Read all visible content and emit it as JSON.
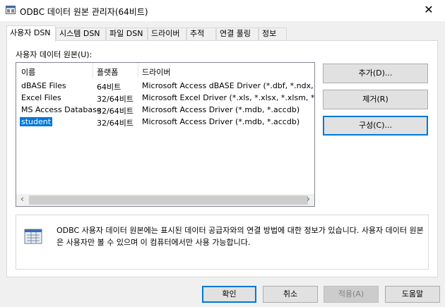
{
  "window": {
    "title": "ODBC 데이터 원본 관리자(64비트)",
    "close_glyph": "✕"
  },
  "tabs": [
    {
      "label": "사용자 DSN"
    },
    {
      "label": "시스템 DSN"
    },
    {
      "label": "파일 DSN"
    },
    {
      "label": "드라이버"
    },
    {
      "label": "추적"
    },
    {
      "label": "연결 풀링"
    },
    {
      "label": "정보"
    }
  ],
  "user_dsn": {
    "list_label": "사용자 데이터 원본(U):",
    "columns": [
      "이름",
      "플랫폼",
      "드라이버"
    ],
    "rows": [
      {
        "name": "dBASE Files",
        "platform": "64비트",
        "driver": "Microsoft Access dBASE Driver (*.dbf, *.ndx, *.mdx)"
      },
      {
        "name": "Excel Files",
        "platform": "32/64비트",
        "driver": "Microsoft Excel Driver (*.xls, *.xlsx, *.xlsm, *.xlsb)"
      },
      {
        "name": "MS Access Database",
        "platform": "32/64비트",
        "driver": "Microsoft Access Driver (*.mdb, *.accdb)"
      },
      {
        "name": "student",
        "platform": "32/64비트",
        "driver": "Microsoft Access Driver (*.mdb, *.accdb)",
        "selected": true
      }
    ],
    "buttons": {
      "add": "추가(D)...",
      "remove": "제거(R)",
      "configure": "구성(C)..."
    },
    "info_text": "ODBC 사용자 데이터 원본에는 표시된 데이터 공급자와의 연결 방법에 대한 정보가 있습니다. 사용자 데이터 원본은 사용자만 볼 수 있으며 이 컴퓨터에서만 사용 가능합니다."
  },
  "footer": {
    "ok": "확인",
    "cancel": "취소",
    "apply": "적용(A)",
    "help": "도움말"
  },
  "icons": {
    "app": "odbc-admin-icon",
    "info": "database-document-icon",
    "scroll_left": "‹",
    "scroll_right": "›"
  },
  "colors": {
    "selection": "#0078d7",
    "default_button_border": "#0078d7"
  }
}
